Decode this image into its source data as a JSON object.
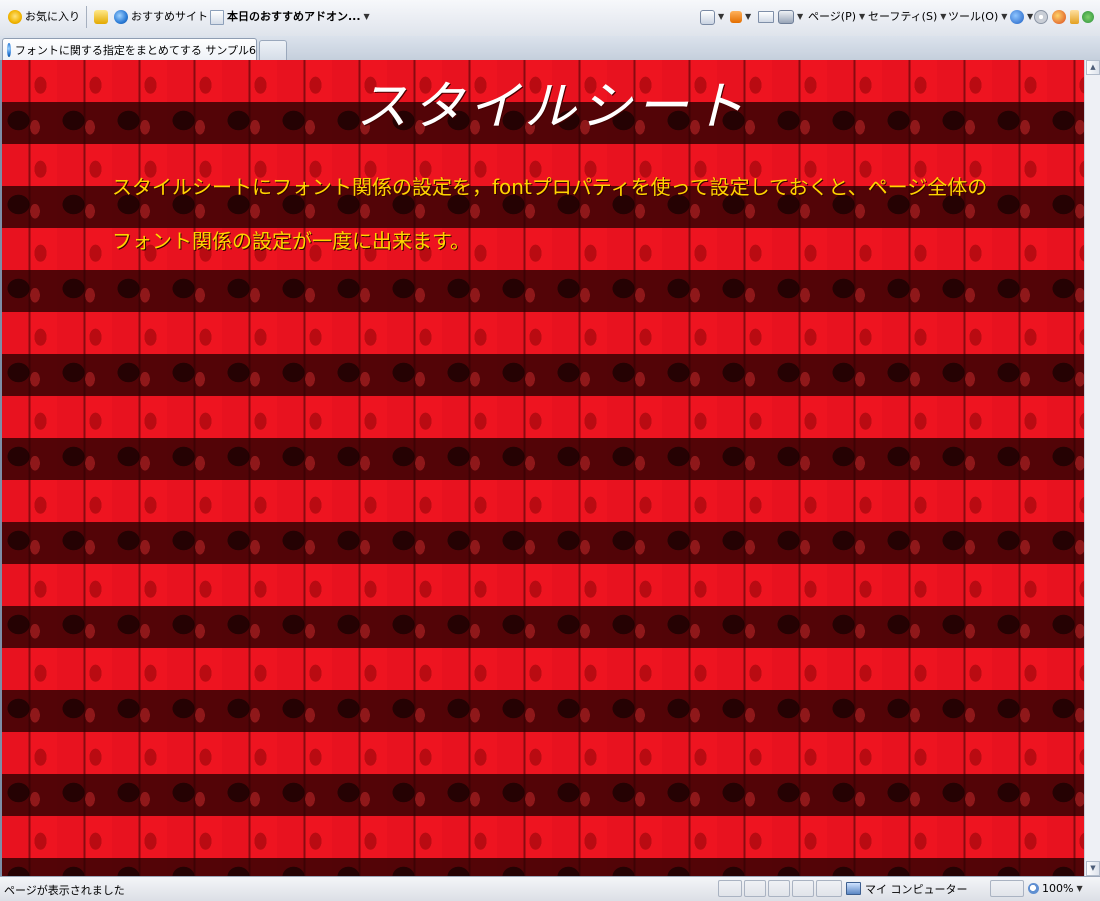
{
  "toolbar": {
    "favorites_label": "お気に入り",
    "suggested_sites_label": "おすすめサイト",
    "addons_label": "本日のおすすめアドオン...",
    "page_menu_label": "ページ(P)",
    "safety_menu_label": "セーフティ(S)",
    "tools_menu_label": "ツール(O)"
  },
  "tabs": {
    "active_title": "フォントに関する指定をまとめてする サンプル6"
  },
  "page": {
    "heading": "スタイルシート",
    "paragraph": "スタイルシートにフォント関係の設定を，fontプロパティを使って設定しておくと、ページ全体のフォント関係の設定が一度に出来ます。",
    "background_color": "#d0101c",
    "heading_color": "#ffffff",
    "text_color": "#ffd400"
  },
  "statusbar": {
    "status_text": "ページが表示されました",
    "zone_label": "マイ コンピューター",
    "zoom_label": "100%"
  },
  "icons": [
    "favorites-star-icon",
    "add-favorite-icon",
    "ie-icon",
    "page-icon",
    "home-icon",
    "rss-icon",
    "mail-icon",
    "print-icon",
    "help-icon",
    "gear-icon",
    "addon-icon",
    "research-icon",
    "msn-icon",
    "computer-icon",
    "zoom-icon"
  ]
}
